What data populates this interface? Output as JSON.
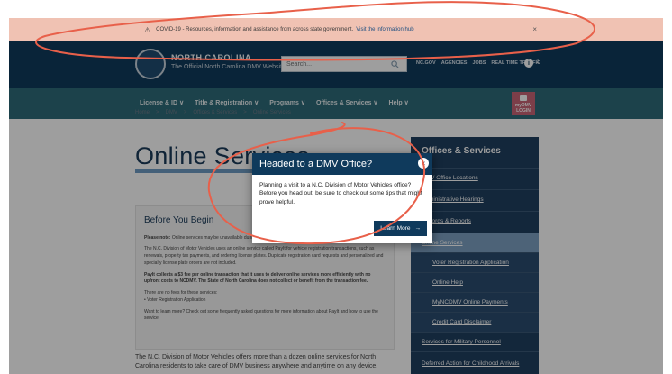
{
  "alert": {
    "text": "COVID-19 - Resources, information and assistance from across state government.",
    "link": "Visit the information hub",
    "close": "×"
  },
  "header": {
    "brand_line1": "NORTH CAROLINA",
    "brand_line2": "The Official North Carolina DMV Website",
    "search_placeholder": "Search...",
    "top_links": [
      "NC.GOV",
      "AGENCIES",
      "JOBS",
      "REAL TIME TRAFFIC"
    ],
    "accessibility_count": "1"
  },
  "nav": {
    "items": [
      "License & ID ∨",
      "Title & Registration ∨",
      "Programs ∨",
      "Offices & Services ∨",
      "Help ∨"
    ],
    "login_label": "myDMV LOGIN"
  },
  "breadcrumbs": [
    "Home",
    ">",
    "DMV",
    ">",
    "Offices & Services",
    ">",
    "Online Services"
  ],
  "page": {
    "title": "Online Services"
  },
  "before": {
    "heading": "Before You Begin",
    "p1_bold": "Please note:",
    "p1": " Online services may be unavailable during scheduled maintenance.",
    "p2": "The N.C. Division of Motor Vehicles uses an online service called PayIt for vehicle registration transactions, such as renewals, property tax payments, and ordering license plates. Duplicate registration card requests and personalized and specialty license plate orders are not included.",
    "p3": "PayIt collects a $3 fee per online transaction that it uses to deliver online services more efficiently with no upfront costs to NCDMV. The State of North Carolina does not collect or benefit from the transaction fee.",
    "p4": "There are no fees for these services:",
    "p4_item": "• Voter Registration Application",
    "p5": "Want to learn more? Check out some frequently asked questions for more information about PayIt and how to use the service."
  },
  "intro": "The N.C. Division of Motor Vehicles offers more than a dozen online services for North Carolina residents to take care of DMV business anywhere and anytime on any device.",
  "sidebar": {
    "heading": "Offices & Services",
    "items": [
      "DMV Office Locations",
      "Administrative Hearings",
      "Records & Reports",
      "Online Services",
      "Voter Registration Application",
      "Online Help",
      "MyNCDMV Online Payments",
      "Credit Card Disclaimer",
      "Services for Military Personnel",
      "Deferred Action for Childhood Arrivals"
    ]
  },
  "modal": {
    "title": "Headed to a DMV Office?",
    "close": "×",
    "body": "Planning a visit to a N.C. Division of Motor Vehicles office? Before you head out, be sure to check out some tips that might prove helpful.",
    "button": "Learn More",
    "button_arrow": "→"
  },
  "colors": {
    "header_bg": "#0f3a5c",
    "nav_bg": "#2e6b7a",
    "alert_bg": "#f0c2b3",
    "sidebar_bg": "#1f3f60",
    "annotation": "#e8604a"
  }
}
